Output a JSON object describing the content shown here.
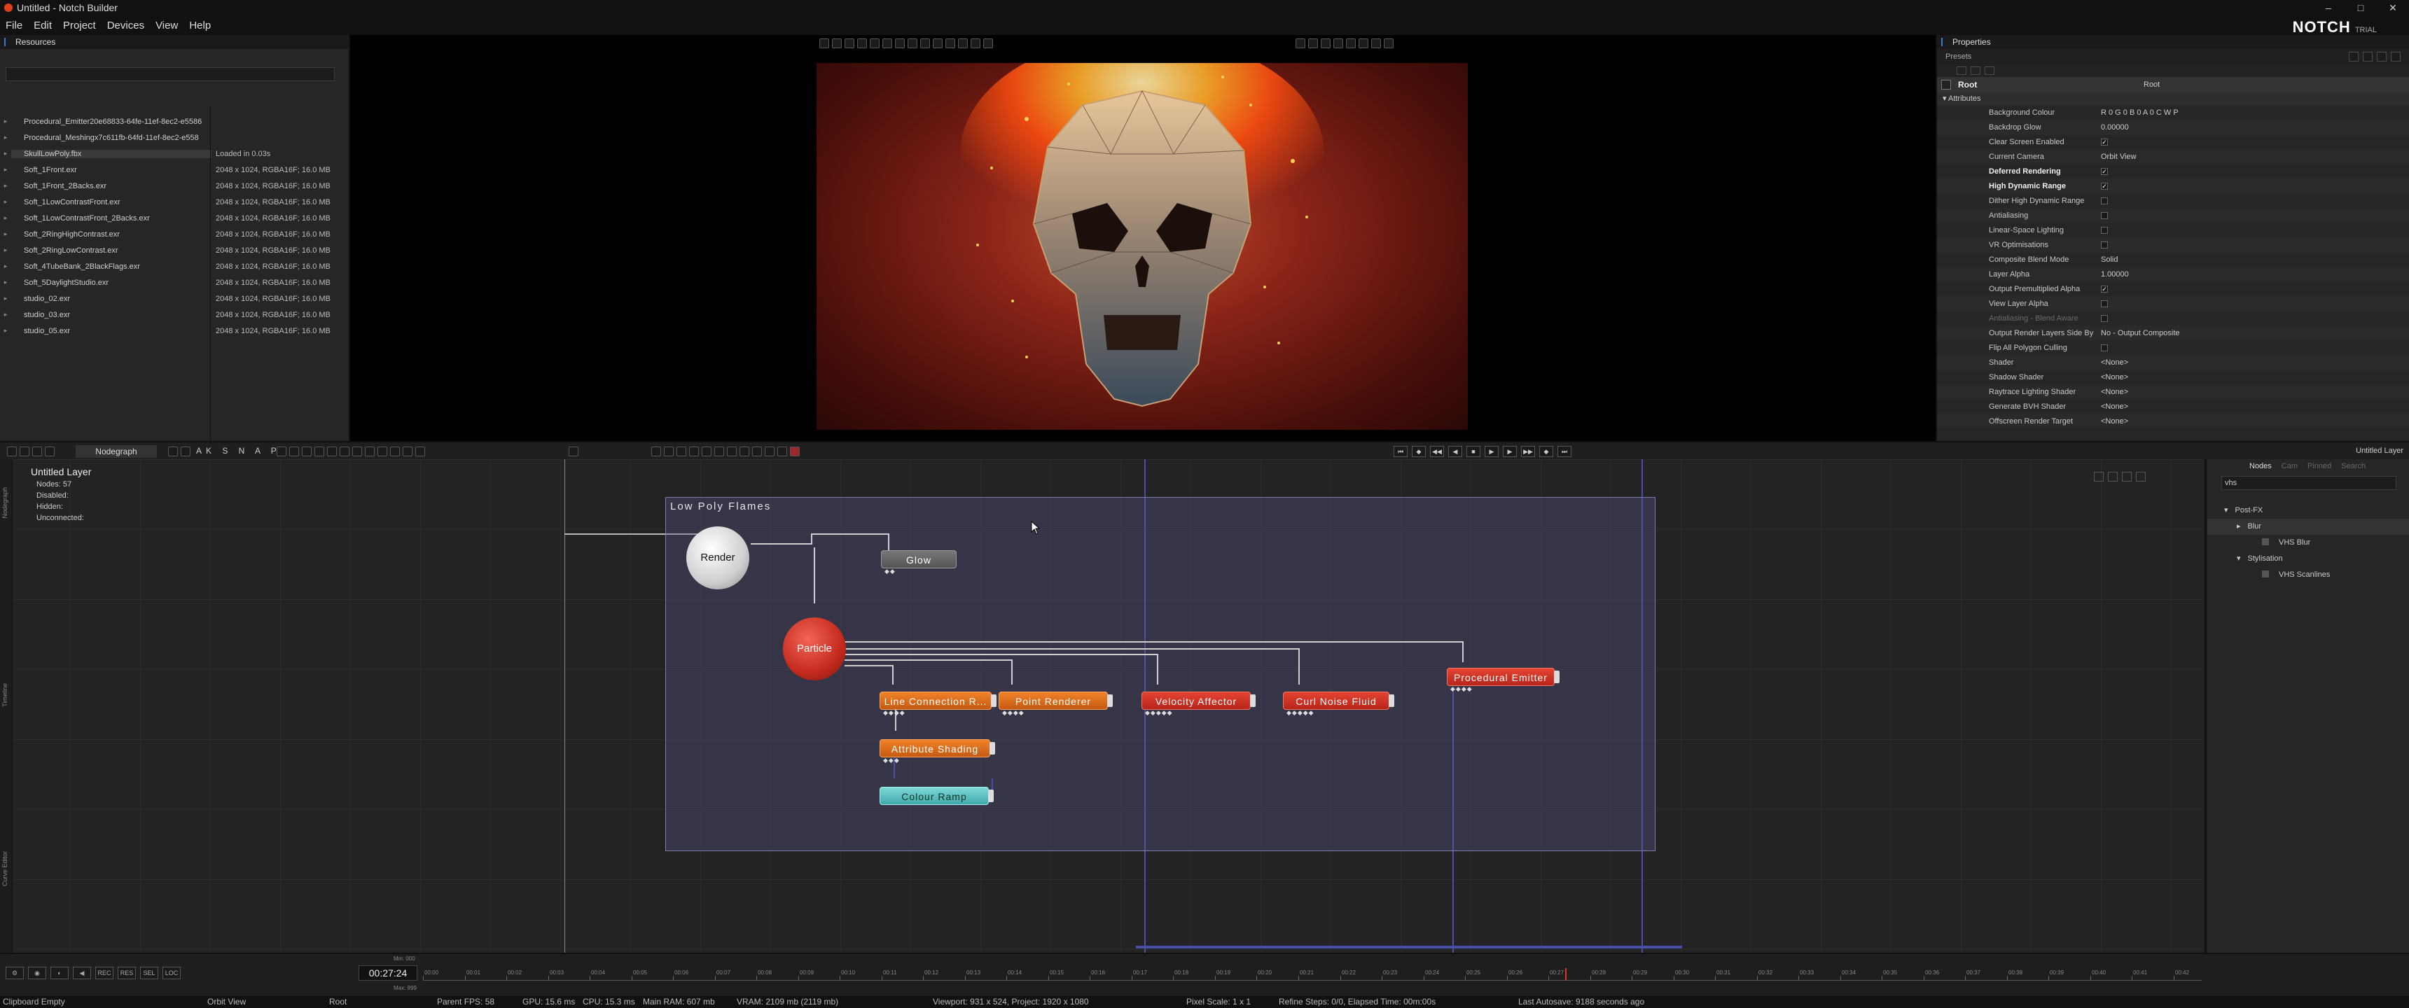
{
  "window": {
    "title": "Untitled - Notch Builder",
    "controls": [
      "–",
      "□",
      "✕"
    ]
  },
  "menu": [
    "File",
    "Edit",
    "Project",
    "Devices",
    "View",
    "Help"
  ],
  "brand": {
    "logo": "NOTCH",
    "edition": "TRIAL"
  },
  "resources": {
    "title": "Resources",
    "items": [
      {
        "name": "Procedural_Emitter20e68833-64fe-11ef-8ec2-e5586",
        "info": ""
      },
      {
        "name": "Procedural_Meshingx7c611fb-64fd-11ef-8ec2-e558",
        "info": ""
      },
      {
        "name": "SkullLowPoly.fbx",
        "info": "Loaded in 0.03s"
      },
      {
        "name": "Soft_1Front.exr",
        "info": "2048 x 1024, RGBA16F; 16.0 MB"
      },
      {
        "name": "Soft_1Front_2Backs.exr",
        "info": "2048 x 1024, RGBA16F; 16.0 MB"
      },
      {
        "name": "Soft_1LowContrastFront.exr",
        "info": "2048 x 1024, RGBA16F; 16.0 MB"
      },
      {
        "name": "Soft_1LowContrastFront_2Backs.exr",
        "info": "2048 x 1024, RGBA16F; 16.0 MB"
      },
      {
        "name": "Soft_2RingHighContrast.exr",
        "info": "2048 x 1024, RGBA16F; 16.0 MB"
      },
      {
        "name": "Soft_2RingLowContrast.exr",
        "info": "2048 x 1024, RGBA16F; 16.0 MB"
      },
      {
        "name": "Soft_4TubeBank_2BlackFlags.exr",
        "info": "2048 x 1024, RGBA16F; 16.0 MB"
      },
      {
        "name": "Soft_5DaylightStudio.exr",
        "info": "2048 x 1024, RGBA16F; 16.0 MB"
      },
      {
        "name": "studio_02.exr",
        "info": "2048 x 1024, RGBA16F; 16.0 MB"
      },
      {
        "name": "studio_03.exr",
        "info": "2048 x 1024, RGBA16F; 16.0 MB"
      },
      {
        "name": "studio_05.exr",
        "info": "2048 x 1024, RGBA16F; 16.0 MB"
      }
    ]
  },
  "properties": {
    "title": "Properties",
    "presets_label": "Presets",
    "root_label": "Root",
    "root_value": "Root",
    "attributes_label": "Attributes",
    "rows": [
      {
        "name": "Background Colour",
        "value": "R 0 G 0 B 0 A 0      C   W   P",
        "style": "normal"
      },
      {
        "name": "Backdrop Glow",
        "value": "0.00000",
        "style": "normal"
      },
      {
        "name": "Clear Screen Enabled",
        "value": "✓",
        "style": "normal",
        "check": true
      },
      {
        "name": "Current Camera",
        "value": "Orbit View",
        "style": "normal"
      },
      {
        "name": "Deferred Rendering",
        "value": "✓",
        "style": "bold",
        "check": true
      },
      {
        "name": "High Dynamic Range",
        "value": "✓",
        "style": "bold",
        "check": true
      },
      {
        "name": "Dither High Dynamic Range",
        "value": "",
        "style": "normal",
        "check": true
      },
      {
        "name": "Antialiasing",
        "value": "",
        "style": "normal",
        "check": true
      },
      {
        "name": "Linear-Space Lighting",
        "value": "",
        "style": "normal",
        "check": true
      },
      {
        "name": "VR Optimisations",
        "value": "",
        "style": "normal",
        "check": true
      },
      {
        "name": "Composite Blend Mode",
        "value": "Solid",
        "style": "normal"
      },
      {
        "name": "Layer Alpha",
        "value": "1.00000",
        "style": "normal"
      },
      {
        "name": "Output Premultiplied Alpha",
        "value": "✓",
        "style": "normal",
        "check": true
      },
      {
        "name": "View Layer Alpha",
        "value": "",
        "style": "normal",
        "check": true
      },
      {
        "name": "Antialiasing - Blend Aware",
        "value": "",
        "style": "dim",
        "check": true
      },
      {
        "name": "Output Render Layers Side By Side",
        "value": "No - Output Composite",
        "style": "normal"
      },
      {
        "name": "Flip All Polygon Culling",
        "value": "",
        "style": "normal",
        "check": true
      },
      {
        "name": "Shader",
        "value": "<None>",
        "style": "normal"
      },
      {
        "name": "Shadow Shader",
        "value": "<None>",
        "style": "normal"
      },
      {
        "name": "Raytrace Lighting Shader",
        "value": "<None>",
        "style": "normal"
      },
      {
        "name": "Generate BVH Shader",
        "value": "<None>",
        "style": "normal"
      },
      {
        "name": "Offscreen Render Target",
        "value": "<None>",
        "style": "normal"
      }
    ]
  },
  "midbar": {
    "tab": "Nodegraph",
    "letters": "AK S N A P",
    "right_label": "Untitled Layer"
  },
  "nodegraph": {
    "layer_title": "Untitled  Layer",
    "stats": [
      "Nodes:   57",
      "Disabled:",
      "Hidden:",
      "Unconnected:"
    ],
    "group_title": "Low  Poly  Flames",
    "nodes": {
      "render": "Render",
      "glow": "Glow",
      "particle": "Particle",
      "line_connection": "Line  Connection  R...",
      "point_renderer": "Point  Renderer",
      "velocity_affector": "Velocity  Affector",
      "curl_noise": "Curl  Noise  Fluid",
      "procedural_emitter": "Procedural  Emitter",
      "attribute_shading": "Attribute  Shading",
      "colour_ramp": "Colour  Ramp"
    },
    "side_tabs": [
      "Nodegraph",
      "Timeline",
      "Curve Editor"
    ]
  },
  "nodes_panel": {
    "tabs": [
      "Nodes",
      "Cam",
      "Pinned",
      "Search"
    ],
    "search": "vhs",
    "tree": [
      {
        "label": "Post-FX",
        "level": 0,
        "expand": "▾"
      },
      {
        "label": "Blur",
        "level": 1,
        "expand": "▸",
        "selected": true
      },
      {
        "label": "VHS Blur",
        "level": 2,
        "leaf": true
      },
      {
        "label": "Stylisation",
        "level": 1,
        "expand": "▾"
      },
      {
        "label": "VHS Scanlines",
        "level": 2,
        "leaf": true
      }
    ]
  },
  "timeline": {
    "time": "00:27:24",
    "min_label": "Min: 000",
    "max_label": "Max: 999",
    "ticks": [
      "00:00",
      "00:01",
      "00:02",
      "00:03",
      "00:04",
      "00:05",
      "00:06",
      "00:07",
      "00:08",
      "00:09",
      "00:10",
      "00:11",
      "00:12",
      "00:13",
      "00:14",
      "00:15",
      "00:16",
      "00:17",
      "00:18",
      "00:19",
      "00:20",
      "00:21",
      "00:22",
      "00:23",
      "00:24",
      "00:25",
      "00:26",
      "00:27",
      "00:28",
      "00:29",
      "00:30",
      "00:31",
      "00:32",
      "00:33",
      "00:34",
      "00:35",
      "00:36",
      "00:37",
      "00:38",
      "00:39",
      "00:40",
      "00:41",
      "00:42"
    ],
    "buttons": [
      "⚙",
      "◉",
      "◐",
      "◀",
      "REC",
      "RES",
      "SEL",
      "LOC"
    ]
  },
  "status": {
    "clipboard": "Clipboard Empty",
    "camera": "Orbit View",
    "root": "Root",
    "fps": "Parent  FPS: 58",
    "gpu": "GPU: 15.6 ms",
    "cpu": "CPU: 15.3 ms",
    "ram": "Main RAM: 607 mb",
    "vram": "VRAM: 2109 mb (2119 mb)",
    "viewport": "Viewport: 931 x 524, Project: 1920 x 1080",
    "pixel_scale": "Pixel Scale: 1 x 1",
    "refine": "Refine Steps: 0/0, Elapsed Time: 00m:00s",
    "autosave": "Last Autosave: 9188 seconds ago"
  },
  "colors": {
    "accent_blue": "#3a7ac8",
    "orange_node": "#e87424",
    "red_node": "#d63a2a",
    "teal_node": "#5cc1c1",
    "group_box": "#585a8c"
  }
}
